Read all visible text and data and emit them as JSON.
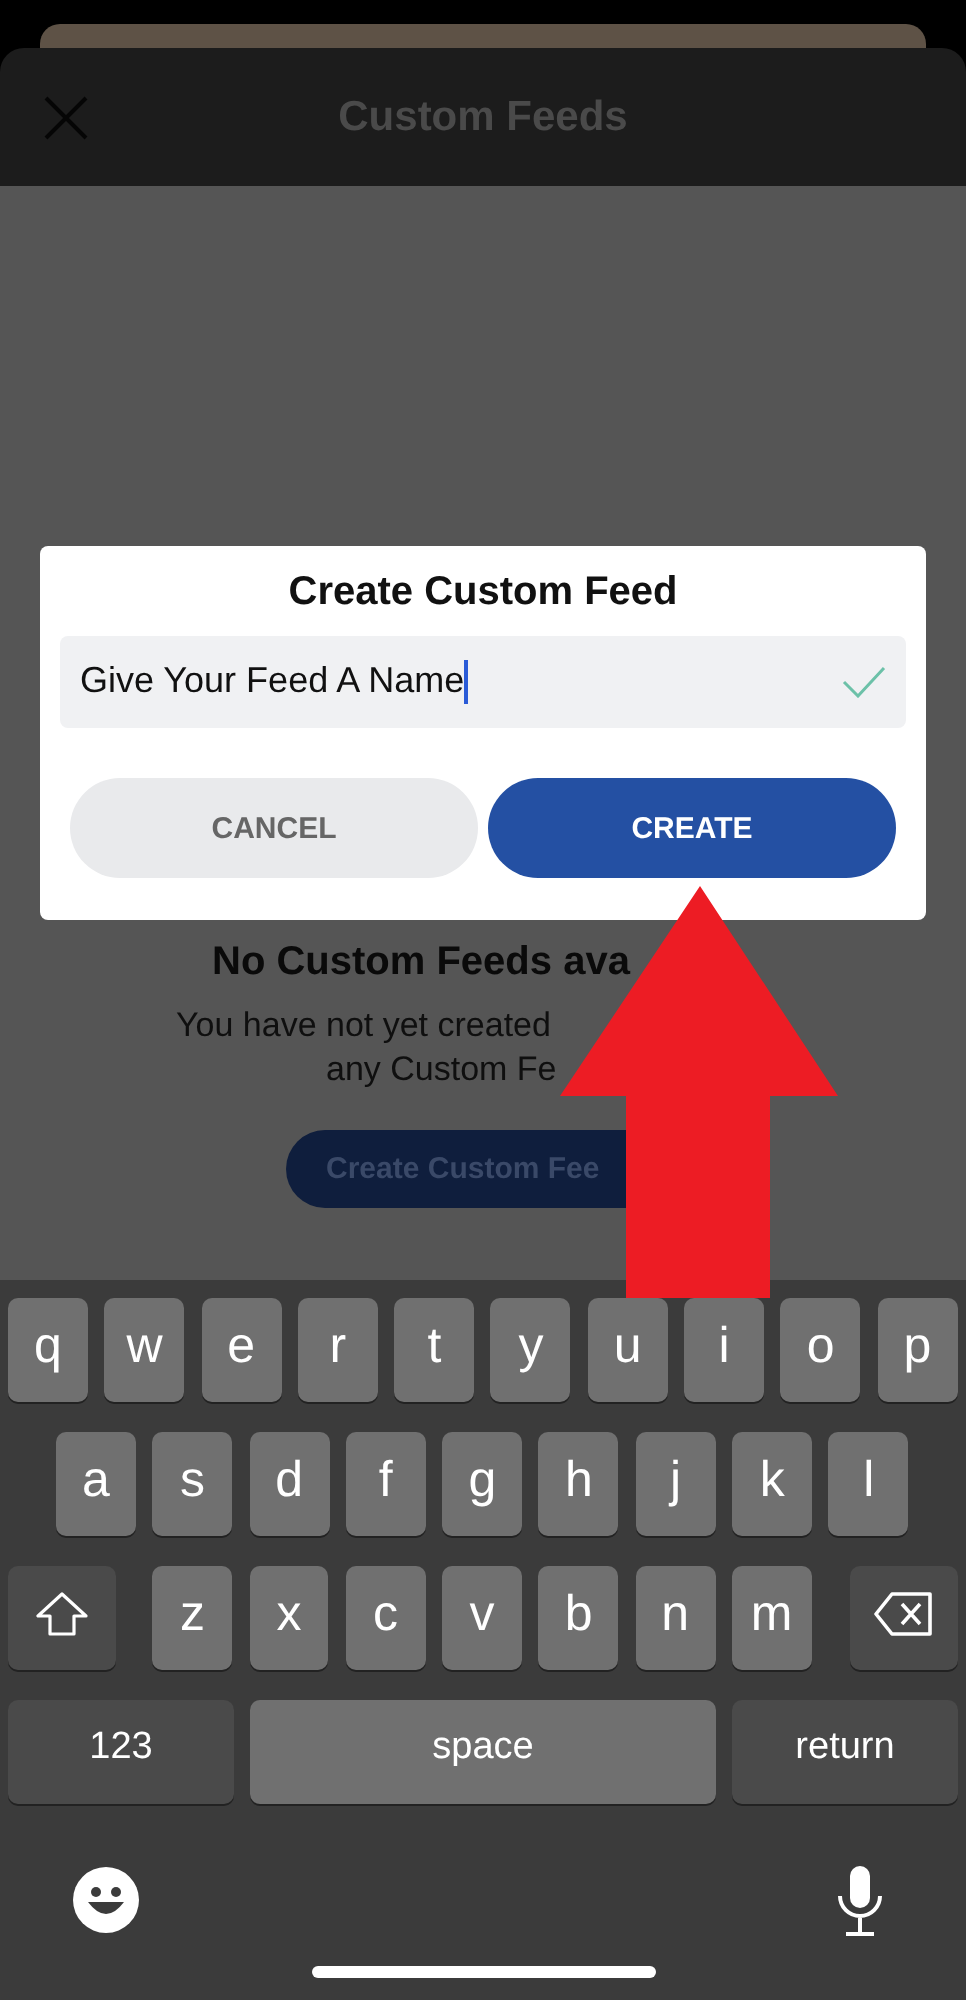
{
  "header": {
    "title": "Custom Feeds"
  },
  "dialog": {
    "title": "Create Custom Feed",
    "field": {
      "value": "Give Your Feed A Name",
      "valid": true
    },
    "buttons": [
      {
        "label": "CANCEL",
        "kind": "secondary"
      },
      {
        "label": "CREATE",
        "kind": "primary"
      }
    ]
  },
  "empty_state": {
    "title": "No Custom Feeds ava",
    "lines": [
      "You have not yet created",
      "any Custom Fe"
    ],
    "button": "Create Custom Fee"
  },
  "keyboard": {
    "rows": [
      [
        {
          "kind": "letter",
          "label": "q"
        },
        {
          "kind": "letter",
          "label": "w"
        },
        {
          "kind": "letter",
          "label": "e"
        },
        {
          "kind": "letter",
          "label": "r"
        },
        {
          "kind": "letter",
          "label": "t"
        },
        {
          "kind": "letter",
          "label": "y"
        },
        {
          "kind": "letter",
          "label": "u"
        },
        {
          "kind": "letter",
          "label": "i"
        },
        {
          "kind": "letter",
          "label": "o"
        },
        {
          "kind": "letter",
          "label": "p"
        }
      ],
      [
        {
          "kind": "letter",
          "label": "a"
        },
        {
          "kind": "letter",
          "label": "s"
        },
        {
          "kind": "letter",
          "label": "d"
        },
        {
          "kind": "letter",
          "label": "f"
        },
        {
          "kind": "letter",
          "label": "g"
        },
        {
          "kind": "letter",
          "label": "h"
        },
        {
          "kind": "letter",
          "label": "j"
        },
        {
          "kind": "letter",
          "label": "k"
        },
        {
          "kind": "letter",
          "label": "l"
        }
      ],
      [
        {
          "kind": "shift"
        },
        {
          "kind": "letter",
          "label": "z"
        },
        {
          "kind": "letter",
          "label": "x"
        },
        {
          "kind": "letter",
          "label": "c"
        },
        {
          "kind": "letter",
          "label": "v"
        },
        {
          "kind": "letter",
          "label": "b"
        },
        {
          "kind": "letter",
          "label": "n"
        },
        {
          "kind": "letter",
          "label": "m"
        },
        {
          "kind": "delete"
        }
      ]
    ],
    "bottom_row": [
      {
        "kind": "function",
        "label": "123"
      },
      {
        "kind": "space",
        "label": "space"
      },
      {
        "kind": "function",
        "label": "return"
      }
    ]
  }
}
